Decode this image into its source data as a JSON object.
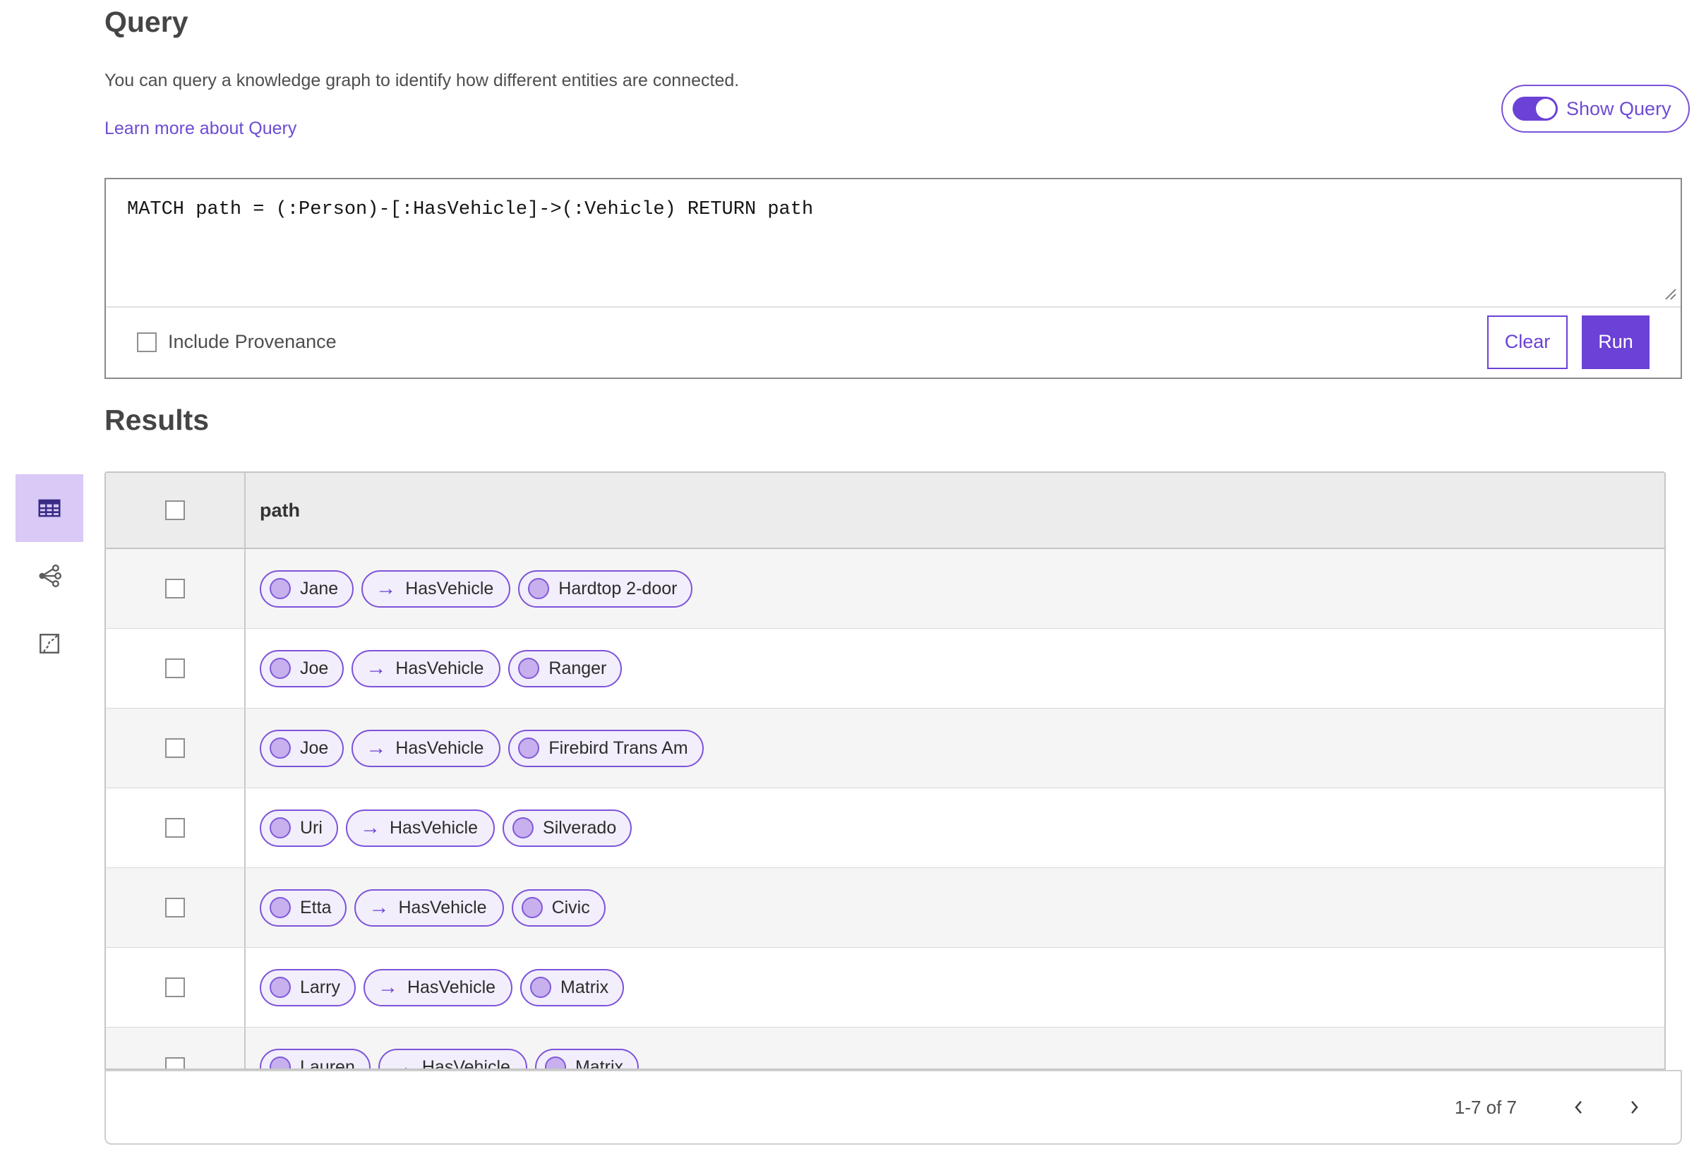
{
  "page": {
    "title": "Query",
    "description": "You can query a knowledge graph to identify how different entities are connected.",
    "learn_more_link": "Learn more about Query"
  },
  "toggle": {
    "label": "Show Query",
    "state": "on"
  },
  "query_panel": {
    "query_text": "MATCH path = (:Person)-[:HasVehicle]->(:Vehicle) RETURN path",
    "include_provenance": {
      "label": "Include Provenance",
      "checked": false
    },
    "buttons": {
      "clear": "Clear",
      "run": "Run"
    }
  },
  "view_switcher": {
    "items": [
      {
        "id": "table-view",
        "icon": "table-icon",
        "selected": true
      },
      {
        "id": "link-chart-view",
        "icon": "link-chart-icon",
        "selected": false
      },
      {
        "id": "map-view",
        "icon": "map-icon",
        "selected": false
      }
    ]
  },
  "results": {
    "heading": "Results",
    "table": {
      "columns": [
        "path"
      ],
      "select_all_checked": false,
      "rows": [
        {
          "source": "Jane",
          "edge": "HasVehicle",
          "target": "Hardtop 2-door",
          "checked": false
        },
        {
          "source": "Joe",
          "edge": "HasVehicle",
          "target": "Ranger",
          "checked": false
        },
        {
          "source": "Joe",
          "edge": "HasVehicle",
          "target": "Firebird Trans Am",
          "checked": false
        },
        {
          "source": "Uri",
          "edge": "HasVehicle",
          "target": "Silverado",
          "checked": false
        },
        {
          "source": "Etta",
          "edge": "HasVehicle",
          "target": "Civic",
          "checked": false
        },
        {
          "source": "Larry",
          "edge": "HasVehicle",
          "target": "Matrix",
          "checked": false
        },
        {
          "source": "Lauren",
          "edge": "HasVehicle",
          "target": "Matrix",
          "checked": false
        }
      ]
    },
    "pagination": {
      "range": "1-7 of 7"
    }
  },
  "icons": {
    "edge_arrow": "→"
  },
  "colors": {
    "primary_purple": "#6b41d6",
    "link_purple": "#6d4bd4",
    "pill_border": "#7d53da",
    "pill_background": "#f2eefb",
    "node_circle_fill": "#c7b0ed",
    "selected_view_background": "#d8c9f6",
    "table_header_background": "#ececec",
    "alt_row_background": "#f5f5f5"
  }
}
